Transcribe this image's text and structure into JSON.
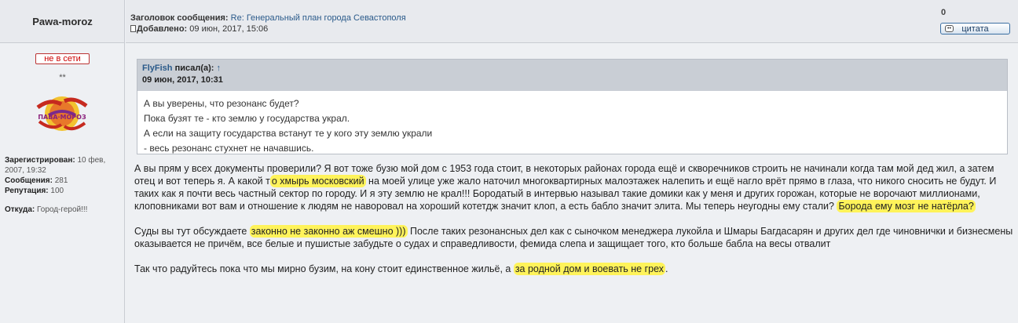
{
  "post": {
    "author": "Pawa-moroz",
    "subject_label": "Заголовок сообщения:",
    "subject": "Re: Генеральный план города Севастополя",
    "added_label": "Добавлено:",
    "added": "09 июн, 2017, 15:06",
    "count": "0",
    "quote_button": "цитата"
  },
  "profile": {
    "status": "не в сети",
    "rank": "**",
    "registered_label": "Зарегистрирован:",
    "registered": "10 фев, 2007, 19:32",
    "messages_label": "Сообщения:",
    "messages": "281",
    "reputation_label": "Репутация:",
    "reputation": "100",
    "location_label": "Откуда:",
    "location": "Город-герой!!!"
  },
  "quote": {
    "author": "FlyFish",
    "wrote": "писал(а):",
    "arrow": "↑",
    "date": "09 июн, 2017, 10:31",
    "lines": [
      "А вы уверены, что резонанс будет?",
      "Пока бузят те - кто землю у государства украл.",
      "А если на защиту государства встанут те у кого эту землю украли",
      "- весь резонанс стухнет не начавшись."
    ]
  },
  "message": {
    "p1_a": "А вы прям у всех документы проверили? Я вот тоже бузю мой дом с 1953 года стоит, в некоторых районах города ещё и скворечников строить не начинали когда там мой дед жил, а затем отец и вот теперь я. А какой т",
    "p1_hl1": "о хмырь московский",
    "p1_b": " на моей улице уже жало наточил многоквартирных малоэтажек налепить и ещё нагло врёт прямо в глаза, что никого сносить не будут. И таких как я почти весь частный сектор по городу. И я эту землю не крал!!! Бородатый в интервью называл такие домики как у меня и других горожан, которые не ворочают миллионами, клоповниками вот вам и отношение к людям не наворовал на хороший котетдж значит клоп, а есть бабло значит элита. Мы теперь неугодны ему стали? ",
    "p1_hl2": "Борода ему мозг не натёрла?",
    "p2_a": "Суды вы тут обсуждаете ",
    "p2_hl": "законно не законно аж смешно )))",
    "p2_b": " После таких резонансных дел как с сыночком менеджера лукойла и Шмары Багдасарян и других дел где чиновнички и бизнесмены оказывается не причём, все белые и пушистые забудьте о судах и справедливости, фемида слепа и защищает того, кто больше бабла на весы отвалит",
    "p3_a": "Так что радуйтесь пока что мы мирно бузим, на кону стоит единственное жильё, а ",
    "p3_hl": "за родной дом и воевать не грех",
    "p3_b": "."
  },
  "colors": {
    "highlight": "#fff35a",
    "link": "#2a5a8a",
    "offline": "#cc0000",
    "header_bg": "#e8eaee",
    "quote_header_bg": "#c9ced5"
  }
}
